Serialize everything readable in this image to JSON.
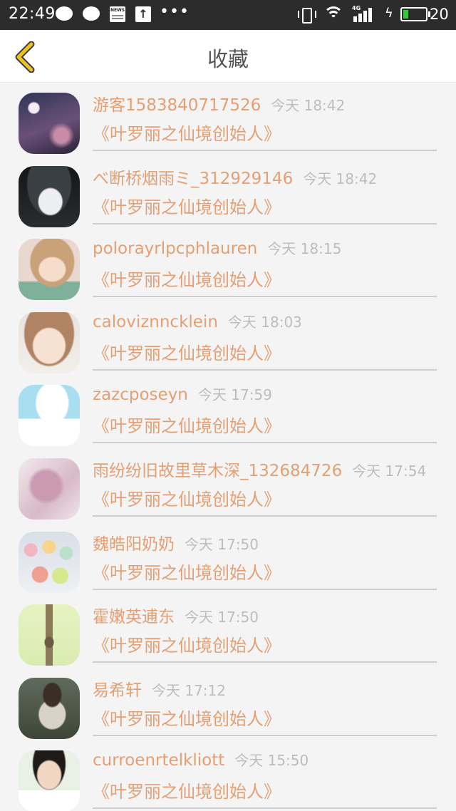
{
  "status_bar": {
    "time": "22:49",
    "news_label": "NEWS",
    "battery_text": "20",
    "network_label": "4G"
  },
  "header": {
    "title": "收藏",
    "back_icon": "chevron-left-icon"
  },
  "colors": {
    "accent": "#e4a074",
    "time": "#bdbdbd",
    "statusbar": "#2c2c2c",
    "back_arrow": "#f0c21b"
  },
  "favorites": [
    {
      "name": "游客1583840717526",
      "time": "今天 18:42",
      "book": "《叶罗丽之仙境创始人》",
      "avatar": "night-sky-avatar"
    },
    {
      "name": "べ断桥烟雨ミ_312929146",
      "time": "今天 18:42",
      "book": "《叶罗丽之仙境创始人》",
      "avatar": "anime-boy-avatar"
    },
    {
      "name": "polorayrlpcphlauren",
      "time": "今天 18:15",
      "book": "《叶罗丽之仙境创始人》",
      "avatar": "girl-portrait-avatar"
    },
    {
      "name": "caloviznncklein",
      "time": "今天 18:03",
      "book": "《叶罗丽之仙境创始人》",
      "avatar": "girl-selfie-avatar"
    },
    {
      "name": "zazcposeyn",
      "time": "今天 17:59",
      "book": "《叶罗丽之仙境创始人》",
      "avatar": "white-dog-avatar"
    },
    {
      "name": "雨纷纷旧故里草木深_132684726",
      "time": "今天 17:54",
      "book": "《叶罗丽之仙境创始人》",
      "avatar": "sketch-girl-avatar"
    },
    {
      "name": "魏皓阳奶奶",
      "time": "今天 17:50",
      "book": "《叶罗丽之仙境创始人》",
      "avatar": "macarons-avatar"
    },
    {
      "name": "霍嫩英逋东",
      "time": "今天 17:50",
      "book": "《叶罗丽之仙境创始人》",
      "avatar": "green-drink-avatar"
    },
    {
      "name": "易希轩",
      "time": "今天 17:12",
      "book": "《叶罗丽之仙境创始人》",
      "avatar": "cooking-boy-avatar"
    },
    {
      "name": "curroenrtelkliott",
      "time": "今天 15:50",
      "book": "《叶罗丽之仙境创始人》",
      "avatar": "young-man-avatar"
    }
  ]
}
